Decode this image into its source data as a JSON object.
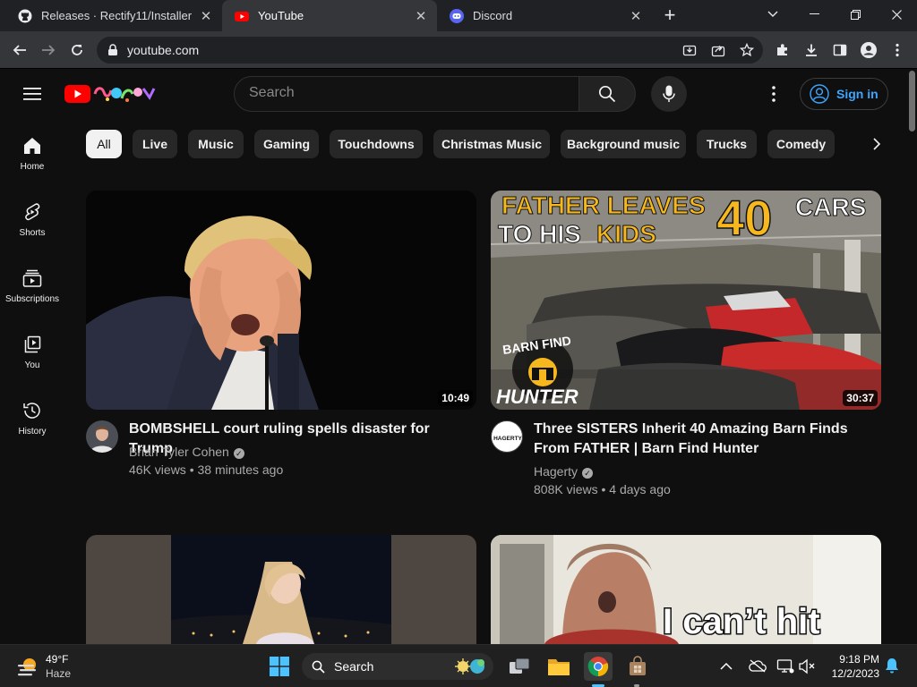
{
  "browser": {
    "tabs": [
      {
        "title": "Releases · Rectify11/Installer",
        "icon": "github-icon",
        "active": false
      },
      {
        "title": "YouTube",
        "icon": "youtube-icon",
        "active": true
      },
      {
        "title": "Discord",
        "icon": "discord-icon",
        "active": false
      }
    ],
    "url": "youtube.com"
  },
  "youtube": {
    "search_placeholder": "Search",
    "sign_in": "Sign in",
    "guide": [
      {
        "label": "Home",
        "icon": "home-icon"
      },
      {
        "label": "Shorts",
        "icon": "shorts-icon"
      },
      {
        "label": "Subscriptions",
        "icon": "subscriptions-icon"
      },
      {
        "label": "You",
        "icon": "you-icon"
      },
      {
        "label": "History",
        "icon": "history-icon"
      }
    ],
    "chips": [
      "All",
      "Live",
      "Music",
      "Gaming",
      "Touchdowns",
      "Christmas Music",
      "Background music",
      "Trucks",
      "Comedy"
    ],
    "videos": [
      {
        "title": "BOMBSHELL court ruling spells disaster for Trump",
        "channel": "Brian Tyler Cohen",
        "views": "46K views",
        "age": "38 minutes ago",
        "duration": "10:49"
      },
      {
        "title": "Three SISTERS Inherit 40 Amazing Barn Finds From FATHER | Barn Find Hunter",
        "channel": "Hagerty",
        "views": "808K views",
        "age": "4 days ago",
        "duration": "30:37",
        "thumb_text": {
          "line1a": "FATHER LEAVES",
          "num": "40",
          "line1b": "CARS",
          "line2a": "TO HIS",
          "line2b": "KIDS",
          "brand1": "BARN FIND",
          "brand2": "HUNTER"
        },
        "avatar_text": "HAGERTY"
      },
      {
        "title": "",
        "thumb_text": ""
      },
      {
        "title": "",
        "thumb_text": "I can’t hit"
      }
    ]
  },
  "taskbar": {
    "weather_temp": "49°F",
    "weather_cond": "Haze",
    "search_label": "Search",
    "time": "9:18 PM",
    "date": "12/2/2023"
  },
  "colors": {
    "yt_bg": "#0f0f0f",
    "chip_bg": "#272727",
    "signin_blue": "#3ea6ff",
    "yt_red": "#ff0000",
    "barn_yellow": "#f7b81d"
  }
}
